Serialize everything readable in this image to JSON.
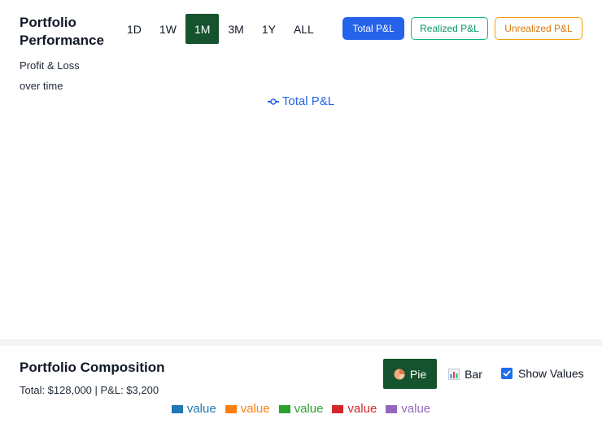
{
  "performance": {
    "title": "Portfolio Performance",
    "subtitle": "Profit & Loss over time",
    "timeframes": [
      {
        "label": "1D",
        "active": false
      },
      {
        "label": "1W",
        "active": false
      },
      {
        "label": "1M",
        "active": true
      },
      {
        "label": "3M",
        "active": false
      },
      {
        "label": "1Y",
        "active": false
      },
      {
        "label": "ALL",
        "active": false
      }
    ],
    "metrics": {
      "total": "Total P&L",
      "realized": "Realized P&L",
      "unrealized": "Unrealized P&L"
    },
    "legend_label": "Total P&L",
    "colors": {
      "total": "#2563eb",
      "realized": "#10b981",
      "unrealized": "#f59e0b",
      "active": "#14532d"
    }
  },
  "composition": {
    "title": "Portfolio Composition",
    "summary": "Total: $128,000 | P&L: $3,200",
    "views": {
      "pie": {
        "label": "Pie",
        "icon": "pie-chart-icon",
        "active": true
      },
      "bar": {
        "label": "Bar",
        "icon": "bar-chart-icon",
        "active": false
      }
    },
    "show_values": {
      "label": "Show Values",
      "checked": true
    },
    "legend": [
      {
        "label": "value",
        "color": "#1f77b4"
      },
      {
        "label": "value",
        "color": "#ff7f0e"
      },
      {
        "label": "value",
        "color": "#2ca02c"
      },
      {
        "label": "value",
        "color": "#d62728"
      },
      {
        "label": "value",
        "color": "#9467bd"
      }
    ]
  }
}
